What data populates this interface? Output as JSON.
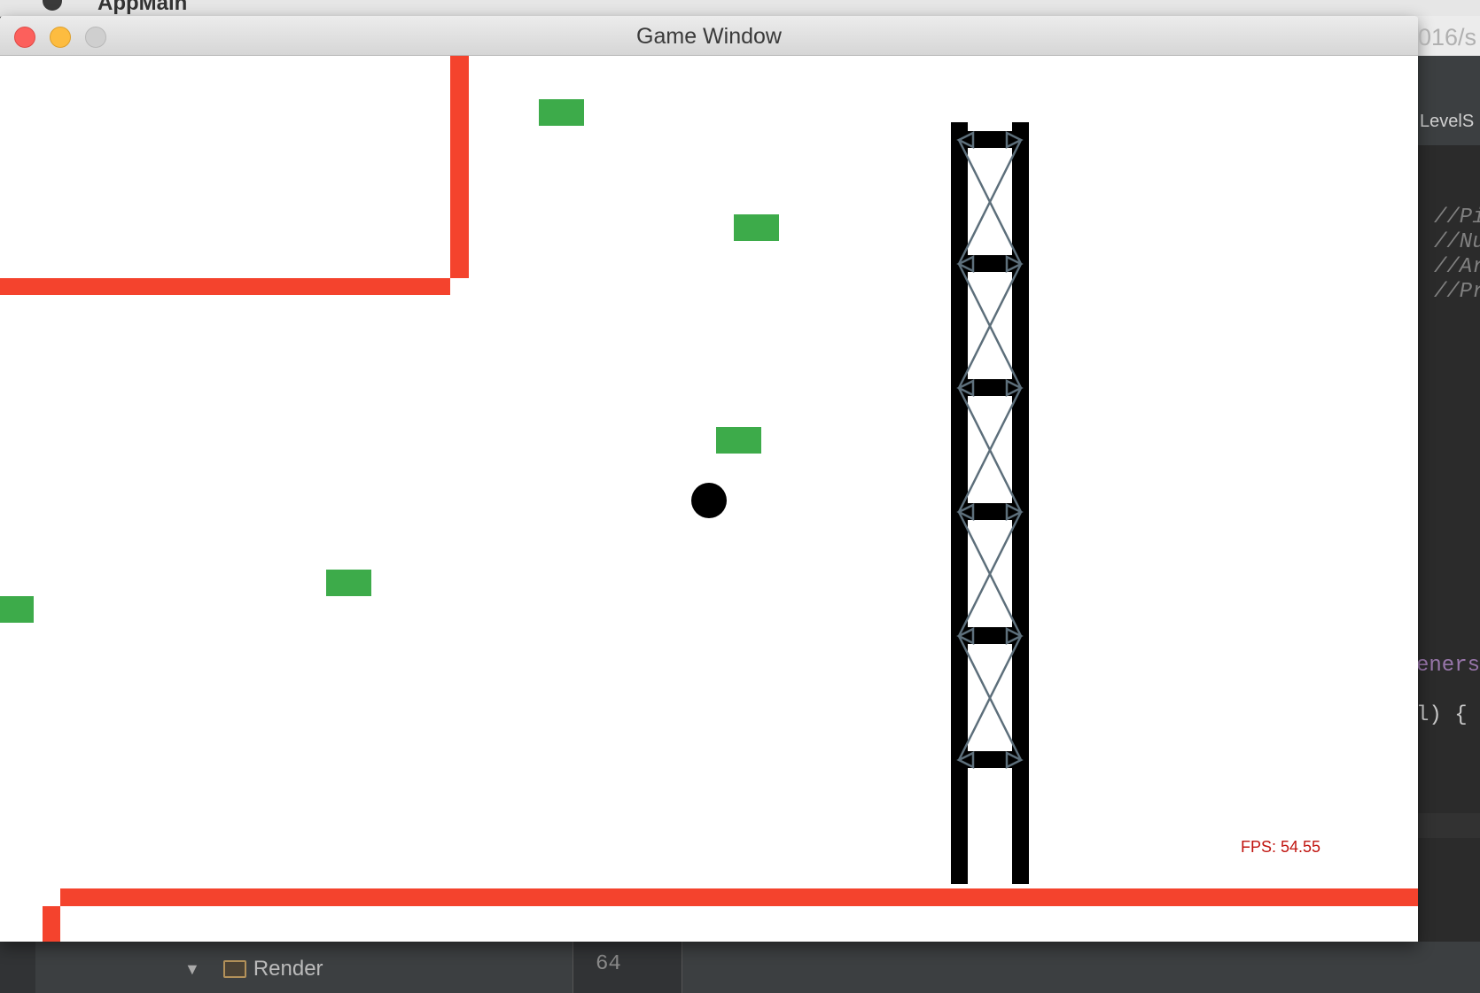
{
  "menubar": {
    "app_name": "AppMain"
  },
  "window": {
    "title": "Game Window",
    "background_text": "016/s"
  },
  "ide": {
    "tab_label": "LevelS",
    "code_comments": [
      "//Pi",
      "//Nu",
      "//Ar",
      "//Pr"
    ],
    "code_fragment_1": "eners",
    "code_fragment_1_end": ";",
    "code_fragment_2": "l) {",
    "tree_node": "Render",
    "line_number": "64"
  },
  "hud": {
    "fps_label": "FPS: 54.55"
  },
  "colors": {
    "wall": "#f4432d",
    "platform": "#3dab4a",
    "ball": "#000000",
    "truss": "#5d6f7b",
    "fps": "#c0140f"
  }
}
